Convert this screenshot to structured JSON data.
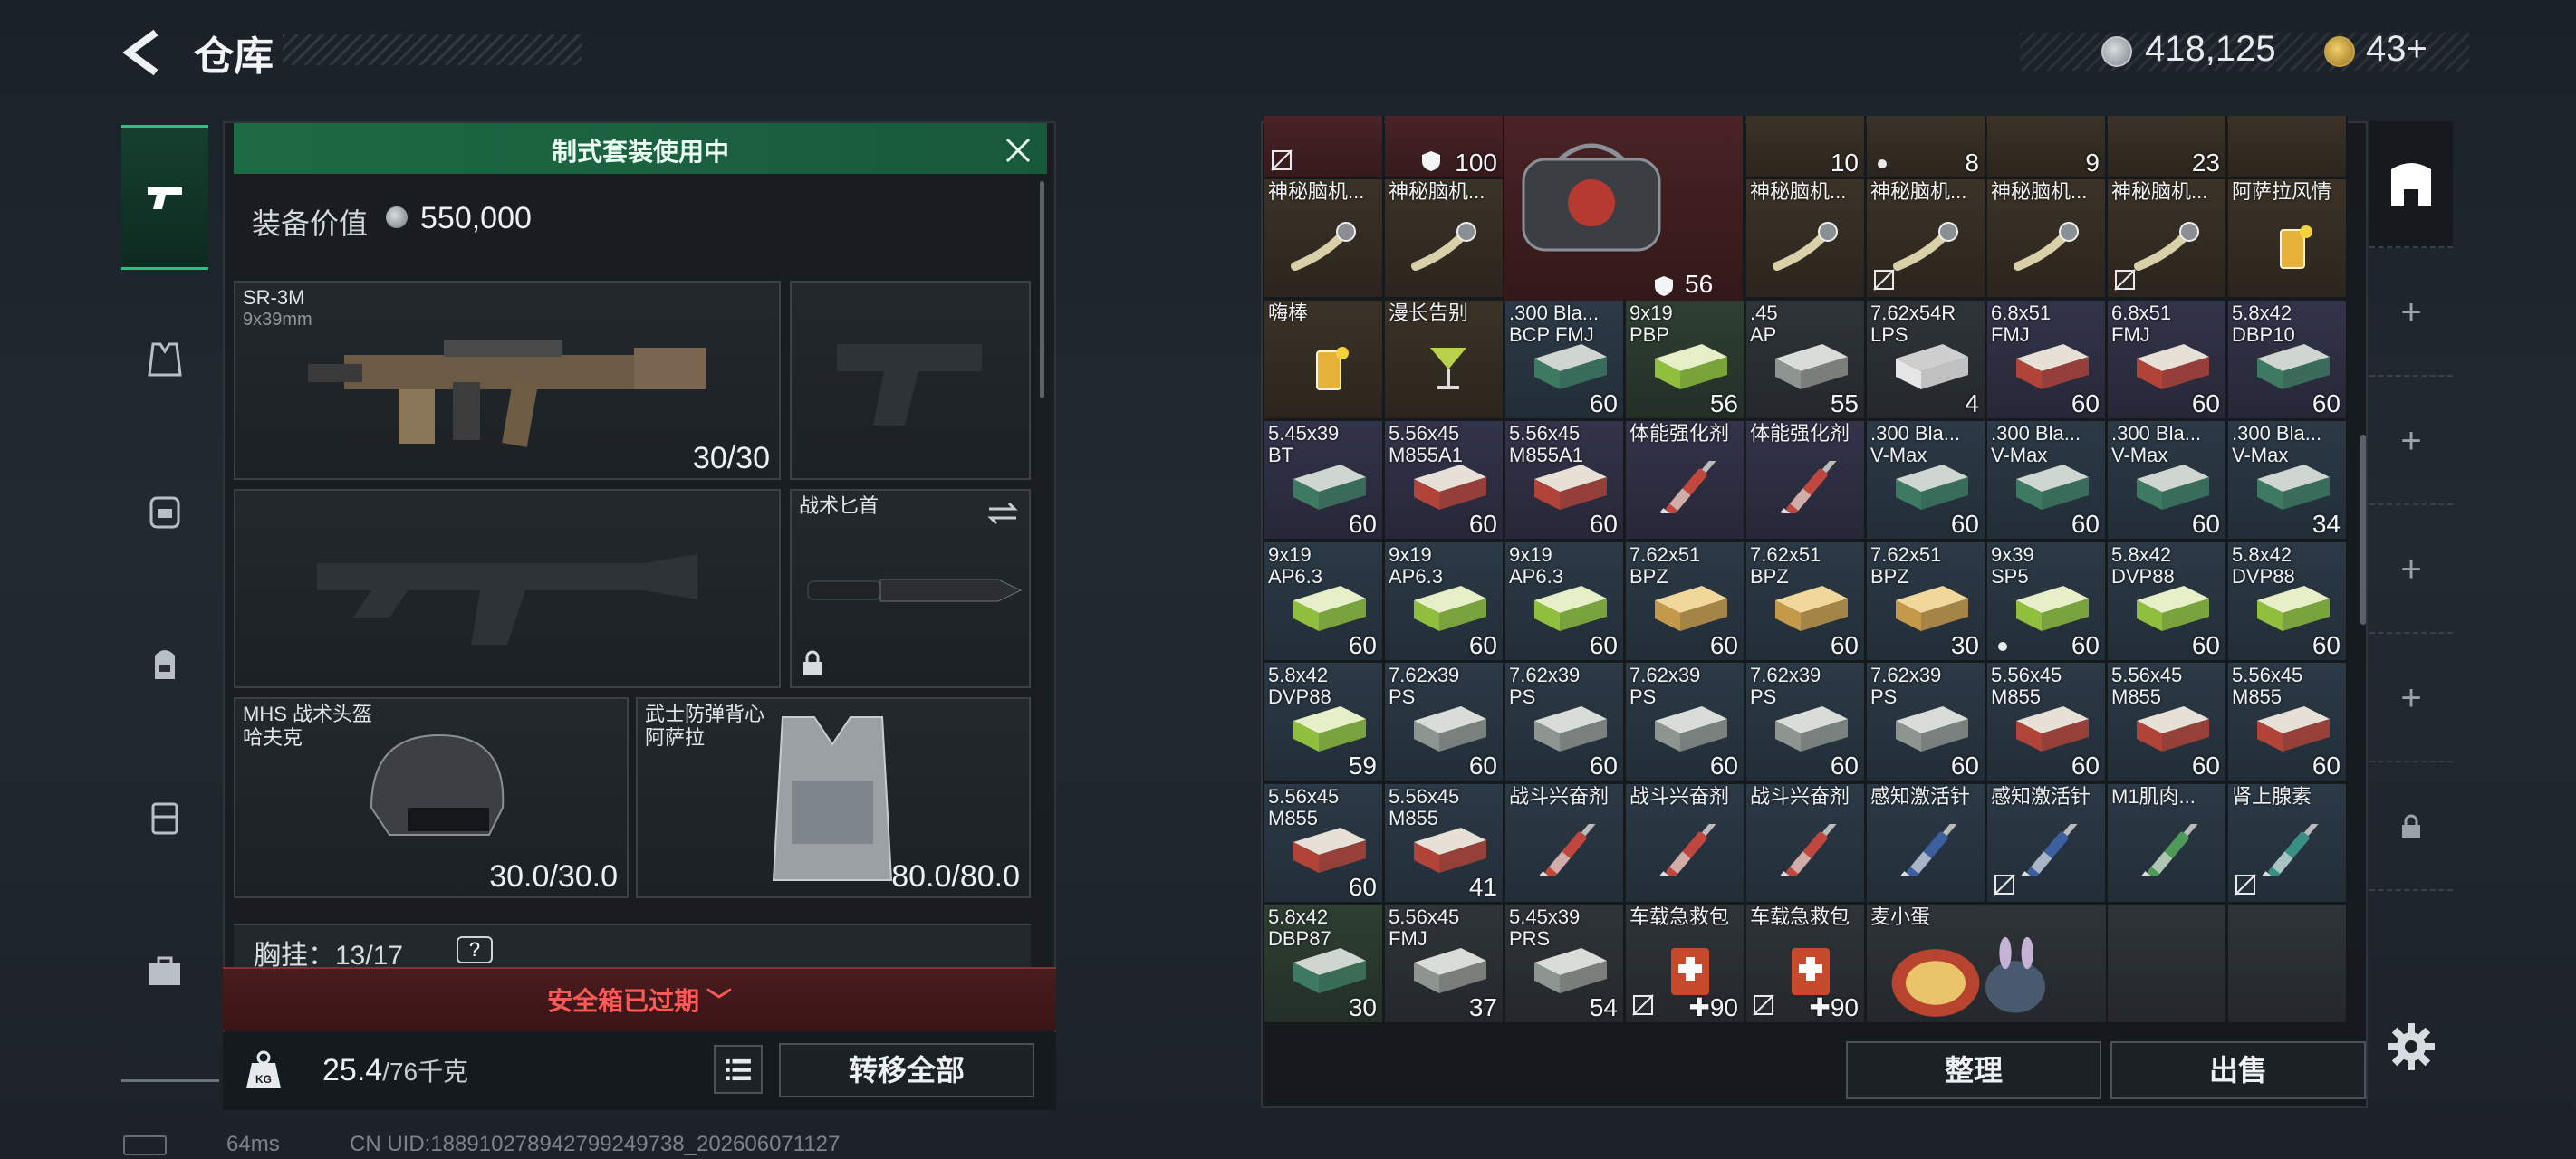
{
  "header": {
    "title": "仓库",
    "coins": "418,125",
    "tokens": "43",
    "tokens_plus": "+"
  },
  "tabs": [
    {
      "name": "weapons"
    },
    {
      "name": "vest"
    },
    {
      "name": "backpack-alt"
    },
    {
      "name": "backpack"
    },
    {
      "name": "case"
    },
    {
      "name": "toolbox"
    }
  ],
  "loadout": {
    "kit_banner": "制式套装使用中",
    "value_label": "装备价值",
    "value": "550,000",
    "primary": {
      "name": "SR-3M",
      "caliber": "9x39mm",
      "ammo": "30/30"
    },
    "knife": {
      "name": "战术匕首"
    },
    "helmet": {
      "name": "MHS 战术头盔",
      "sub": "哈夫克",
      "durability": "30.0/30.0"
    },
    "armor": {
      "name": "武士防弹背心",
      "sub": "阿萨拉",
      "durability": "80.0/80.0"
    },
    "chest_rig": {
      "label": "胸挂：",
      "value": "13/17",
      "help": "?"
    },
    "safebox": "安全箱已过期",
    "weight": "25.4",
    "weight_max": "/76千克",
    "transfer_all": "转移全部"
  },
  "status": {
    "ping": "64ms",
    "uid": "CN UID:188910278942799249738_202606071127"
  },
  "inventory": {
    "top_row": [
      {
        "count": "",
        "nosell": true
      },
      {
        "count": "100",
        "shield": true
      },
      {
        "count": "10"
      },
      {
        "count": "8",
        "dot": true
      },
      {
        "count": "9"
      },
      {
        "count": "23"
      },
      {
        "count": ""
      }
    ],
    "bag_count": "56",
    "rows": [
      [
        {
          "name": "神秘脑机...",
          "count": "",
          "color": "c-brown",
          "img": "usb"
        },
        {
          "name": "神秘脑机...",
          "count": "",
          "color": "c-brown",
          "img": "usb"
        },
        {
          "skip": true
        },
        {
          "skip": true
        },
        {
          "name": "神秘脑机...",
          "count": "",
          "color": "c-brown",
          "img": "usb"
        },
        {
          "name": "神秘脑机...",
          "count": "",
          "color": "c-brown",
          "img": "usb",
          "nosell": true
        },
        {
          "name": "神秘脑机...",
          "count": "",
          "color": "c-brown",
          "img": "usb"
        },
        {
          "name": "神秘脑机...",
          "count": "",
          "color": "c-brown",
          "img": "usb",
          "nosell": true
        },
        {
          "name": "阿萨拉风情",
          "count": "",
          "color": "c-brown",
          "img": "drink"
        }
      ],
      [
        {
          "name": "嗨棒",
          "count": "",
          "color": "c-brown",
          "img": "drink"
        },
        {
          "name": "漫长告别",
          "count": "",
          "color": "c-brown",
          "img": "cocktail"
        },
        {
          "name": ".300 Bla...\nBCP FMJ",
          "count": "60",
          "color": "c-blue",
          "img": "ammo-green"
        },
        {
          "name": "9x19\nPBP",
          "count": "56",
          "color": "c-green",
          "img": "ammo-lime"
        },
        {
          "name": ".45\nAP",
          "count": "55",
          "color": "c-gray",
          "img": "ammo-gray"
        },
        {
          "name": "7.62x54R\nLPS",
          "count": "4",
          "color": "c-gray",
          "img": "ammo-white"
        },
        {
          "name": "6.8x51\nFMJ",
          "count": "60",
          "color": "c-purple",
          "img": "ammo-red"
        },
        {
          "name": "6.8x51\nFMJ",
          "count": "60",
          "color": "c-purple",
          "img": "ammo-red"
        },
        {
          "name": "5.8x42\nDBP10",
          "count": "60",
          "color": "c-purple",
          "img": "ammo-green"
        }
      ],
      [
        {
          "name": "5.45x39\nBT",
          "count": "60",
          "color": "c-purple",
          "img": "ammo-green"
        },
        {
          "name": "5.56x45\nM855A1",
          "count": "60",
          "color": "c-purple",
          "img": "ammo-red"
        },
        {
          "name": "5.56x45\nM855A1",
          "count": "60",
          "color": "c-purple",
          "img": "ammo-red"
        },
        {
          "name": "体能强化剂",
          "count": "",
          "color": "c-purple",
          "img": "syringe-red"
        },
        {
          "name": "体能强化剂",
          "count": "",
          "color": "c-purple",
          "img": "syringe-red"
        },
        {
          "name": ".300 Bla...\nV-Max",
          "count": "60",
          "color": "c-blue",
          "img": "ammo-green"
        },
        {
          "name": ".300 Bla...\nV-Max",
          "count": "60",
          "color": "c-blue",
          "img": "ammo-green"
        },
        {
          "name": ".300 Bla...\nV-Max",
          "count": "60",
          "color": "c-blue",
          "img": "ammo-green"
        },
        {
          "name": ".300 Bla...\nV-Max",
          "count": "34",
          "color": "c-blue",
          "img": "ammo-green"
        }
      ],
      [
        {
          "name": "9x19\nAP6.3",
          "count": "60",
          "color": "c-blue",
          "img": "ammo-lime"
        },
        {
          "name": "9x19\nAP6.3",
          "count": "60",
          "color": "c-blue",
          "img": "ammo-lime"
        },
        {
          "name": "9x19\nAP6.3",
          "count": "60",
          "color": "c-blue",
          "img": "ammo-lime"
        },
        {
          "name": "7.62x51\nBPZ",
          "count": "60",
          "color": "c-blue",
          "img": "ammo-tan"
        },
        {
          "name": "7.62x51\nBPZ",
          "count": "60",
          "color": "c-blue",
          "img": "ammo-tan"
        },
        {
          "name": "7.62x51\nBPZ",
          "count": "30",
          "color": "c-blue",
          "img": "ammo-tan"
        },
        {
          "name": "9x39\nSP5",
          "count": "60",
          "color": "c-blue",
          "img": "ammo-lime",
          "dot": true
        },
        {
          "name": "5.8x42\nDVP88",
          "count": "60",
          "color": "c-blue",
          "img": "ammo-lime"
        },
        {
          "name": "5.8x42\nDVP88",
          "count": "60",
          "color": "c-blue",
          "img": "ammo-lime"
        }
      ],
      [
        {
          "name": "5.8x42\nDVP88",
          "count": "59",
          "color": "c-blue",
          "img": "ammo-lime"
        },
        {
          "name": "7.62x39\nPS",
          "count": "60",
          "color": "c-blue",
          "img": "ammo-gray"
        },
        {
          "name": "7.62x39\nPS",
          "count": "60",
          "color": "c-blue",
          "img": "ammo-gray"
        },
        {
          "name": "7.62x39\nPS",
          "count": "60",
          "color": "c-blue",
          "img": "ammo-gray"
        },
        {
          "name": "7.62x39\nPS",
          "count": "60",
          "color": "c-blue",
          "img": "ammo-gray"
        },
        {
          "name": "7.62x39\nPS",
          "count": "60",
          "color": "c-blue",
          "img": "ammo-gray"
        },
        {
          "name": "5.56x45\nM855",
          "count": "60",
          "color": "c-blue",
          "img": "ammo-red"
        },
        {
          "name": "5.56x45\nM855",
          "count": "60",
          "color": "c-blue",
          "img": "ammo-red"
        },
        {
          "name": "5.56x45\nM855",
          "count": "60",
          "color": "c-blue",
          "img": "ammo-red"
        }
      ],
      [
        {
          "name": "5.56x45\nM855",
          "count": "60",
          "color": "c-blue",
          "img": "ammo-red"
        },
        {
          "name": "5.56x45\nM855",
          "count": "41",
          "color": "c-blue",
          "img": "ammo-red"
        },
        {
          "name": "战斗兴奋剂",
          "count": "",
          "color": "c-blue",
          "img": "syringe-red"
        },
        {
          "name": "战斗兴奋剂",
          "count": "",
          "color": "c-blue",
          "img": "syringe-red"
        },
        {
          "name": "战斗兴奋剂",
          "count": "",
          "color": "c-blue",
          "img": "syringe-red"
        },
        {
          "name": "感知激活针",
          "count": "",
          "color": "c-blue",
          "img": "syringe-blue"
        },
        {
          "name": "感知激活针",
          "count": "",
          "color": "c-blue",
          "img": "syringe-blue",
          "nosell": true
        },
        {
          "name": "M1肌肉...",
          "count": "",
          "color": "c-blue",
          "img": "syringe-green"
        },
        {
          "name": "肾上腺素",
          "count": "",
          "color": "c-blue",
          "img": "syringe-teal",
          "nosell": true
        }
      ],
      [
        {
          "name": "5.8x42\nDBP87",
          "count": "30",
          "color": "c-green",
          "img": "ammo-green"
        },
        {
          "name": "5.56x45\nFMJ",
          "count": "37",
          "color": "c-gray",
          "img": "ammo-gray"
        },
        {
          "name": "5.45x39\nPRS",
          "count": "54",
          "color": "c-gray",
          "img": "ammo-gray"
        },
        {
          "name": "车载急救包",
          "count": "90",
          "color": "c-gray",
          "img": "medkit",
          "nosell": true,
          "plus": true
        },
        {
          "name": "车载急救包",
          "count": "90",
          "color": "c-gray",
          "img": "medkit",
          "nosell": true,
          "plus": true
        },
        {
          "name": "麦小蛋",
          "count": "",
          "color": "c-gray",
          "img": "egg",
          "wide": true
        },
        {
          "skip": true
        },
        {
          "name": "",
          "count": "",
          "color": "c-gray",
          "img": ""
        },
        {
          "name": "",
          "count": "",
          "color": "c-gray",
          "img": ""
        }
      ]
    ],
    "sort": "整理",
    "sell": "出售"
  },
  "rail": [
    "stash-icon",
    "add",
    "add",
    "add",
    "add",
    "lock"
  ]
}
